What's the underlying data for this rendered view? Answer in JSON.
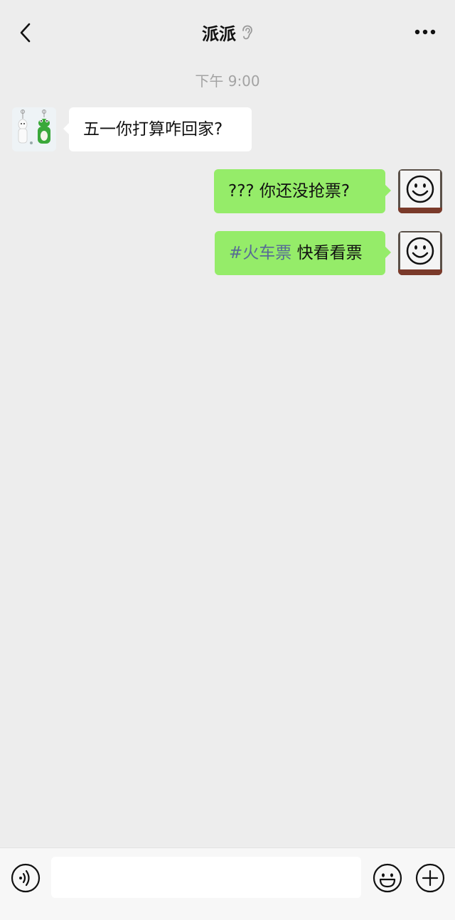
{
  "header": {
    "title": "派派",
    "back_icon": "chevron-left-icon",
    "status_icon": "ear-icon",
    "more_icon": "more-dots-icon"
  },
  "timestamp": "下午 9:00",
  "messages": [
    {
      "direction": "in",
      "text": "五一你打算咋回家?"
    },
    {
      "direction": "out",
      "text": "??? 你还没抢票?"
    },
    {
      "direction": "out",
      "hashtag": "#火车票",
      "text": "快看看票"
    }
  ],
  "input_bar": {
    "voice_icon": "voice-icon",
    "input_value": "",
    "emoji_icon": "emoji-icon",
    "plus_icon": "plus-icon"
  },
  "colors": {
    "background": "#ededed",
    "bubble_out": "#95ec69",
    "bubble_in": "#ffffff",
    "hashtag": "#576b95"
  }
}
